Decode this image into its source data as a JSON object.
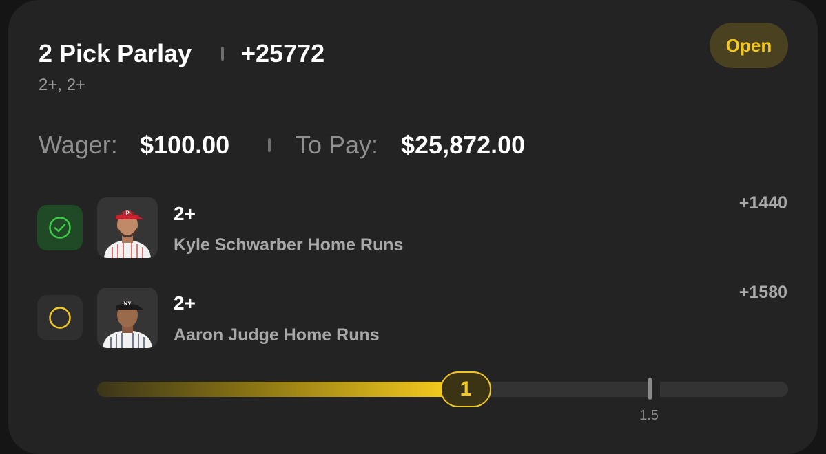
{
  "bet": {
    "title": "2 Pick Parlay",
    "total_odds": "+25772",
    "subtitle": "2+, 2+",
    "status": "Open",
    "wager_label": "Wager:",
    "wager_value": "$100.00",
    "topay_label": "To Pay:",
    "topay_value": "$25,872.00"
  },
  "legs": [
    {
      "line": "2+",
      "market": "Kyle Schwarber Home Runs",
      "odds": "+1440",
      "status": "won",
      "avatar": "player-headshot-phillies"
    },
    {
      "line": "2+",
      "market": "Aaron Judge Home Runs",
      "odds": "+1580",
      "status": "pending",
      "avatar": "player-headshot-yankees"
    }
  ],
  "progress": {
    "current": "1",
    "target": "1.5",
    "fill_fraction": 0.5
  },
  "colors": {
    "accent": "#f2c81e",
    "won": "#3dcc4a",
    "card": "#232323"
  }
}
